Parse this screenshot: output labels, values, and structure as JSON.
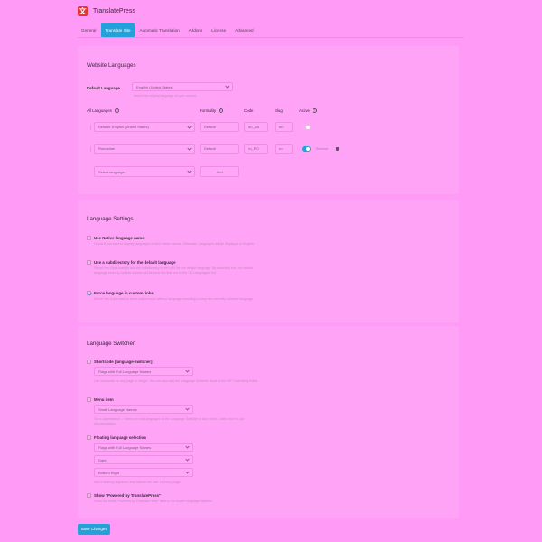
{
  "app": {
    "title": "TranslatePress",
    "logo_glyph": "文"
  },
  "tabs": [
    {
      "label": "General"
    },
    {
      "label": "Translate Site",
      "active": true
    },
    {
      "label": "Automatic Translation"
    },
    {
      "label": "Addons"
    },
    {
      "label": "License"
    },
    {
      "label": "Advanced"
    }
  ],
  "website_languages": {
    "title": "Website Languages",
    "default_language_label": "Default Language",
    "default_language_value": "English (United States)",
    "default_language_hint": "Select the original language of your content.",
    "columns": {
      "all_languages": "All Languages",
      "formality": "Formality",
      "code": "Code",
      "slug": "Slug",
      "active": "Active"
    },
    "rows": [
      {
        "language": "Default: English (United States)",
        "formality": "Default",
        "code": "en_US",
        "slug": "en",
        "active": true
      },
      {
        "language": "Romanian",
        "formality": "Default",
        "code": "ro_RO",
        "slug": "ro",
        "active": true,
        "remove_label": "Remove"
      }
    ],
    "select_language_placeholder": "Select language",
    "add_label": "Add"
  },
  "language_settings": {
    "title": "Language Settings",
    "options": [
      {
        "label": "Use Native language name",
        "checked": false,
        "desc": "Check if you want to display languages in their native names. Otherwise, languages will be displayed in English."
      },
      {
        "label": "Use a subdirectory for the default language",
        "checked": false,
        "desc": "Select Yes if you want to add the subdirectory in the URL for the default language. By selecting Yes, the default language seen by website visitors will become the first one in the \"All Languages\" list."
      },
      {
        "label": "Force language in custom links",
        "checked": true,
        "desc": "Select Yes if you want to force custom links without language encoding to keep the currently selected language."
      }
    ]
  },
  "language_switcher": {
    "title": "Language Switcher",
    "shortcode": {
      "label": "Shortcode [language-switcher]",
      "select_value": "Flags with Full Language Names",
      "desc": "Use shortcode on any page or widget. You can also add the Language Switcher Block in the WP Gutenberg Editor."
    },
    "menu_item": {
      "label": "Menu item",
      "select_value": "Small Language Names",
      "desc": "Go to Appearance -> Menus to add languages to the Language Switcher in any menu. Learn more in our documentation."
    },
    "floating": {
      "label": "Floating language selection",
      "selects": [
        "Flags with Full Language Names",
        "Dark",
        "Bottom Right"
      ],
      "desc": "Add a floating dropdown that follows the user on every page."
    },
    "powered_by": {
      "label": "Show \"Powered by TranslatePress\"",
      "desc": "Show the small \"Powered by TranslatePress\" label in the floater language switcher."
    }
  },
  "save_label": "Save Changes",
  "colors": {
    "accent": "#24a1d8",
    "background": "#ff9af6",
    "danger": "#e33535"
  }
}
